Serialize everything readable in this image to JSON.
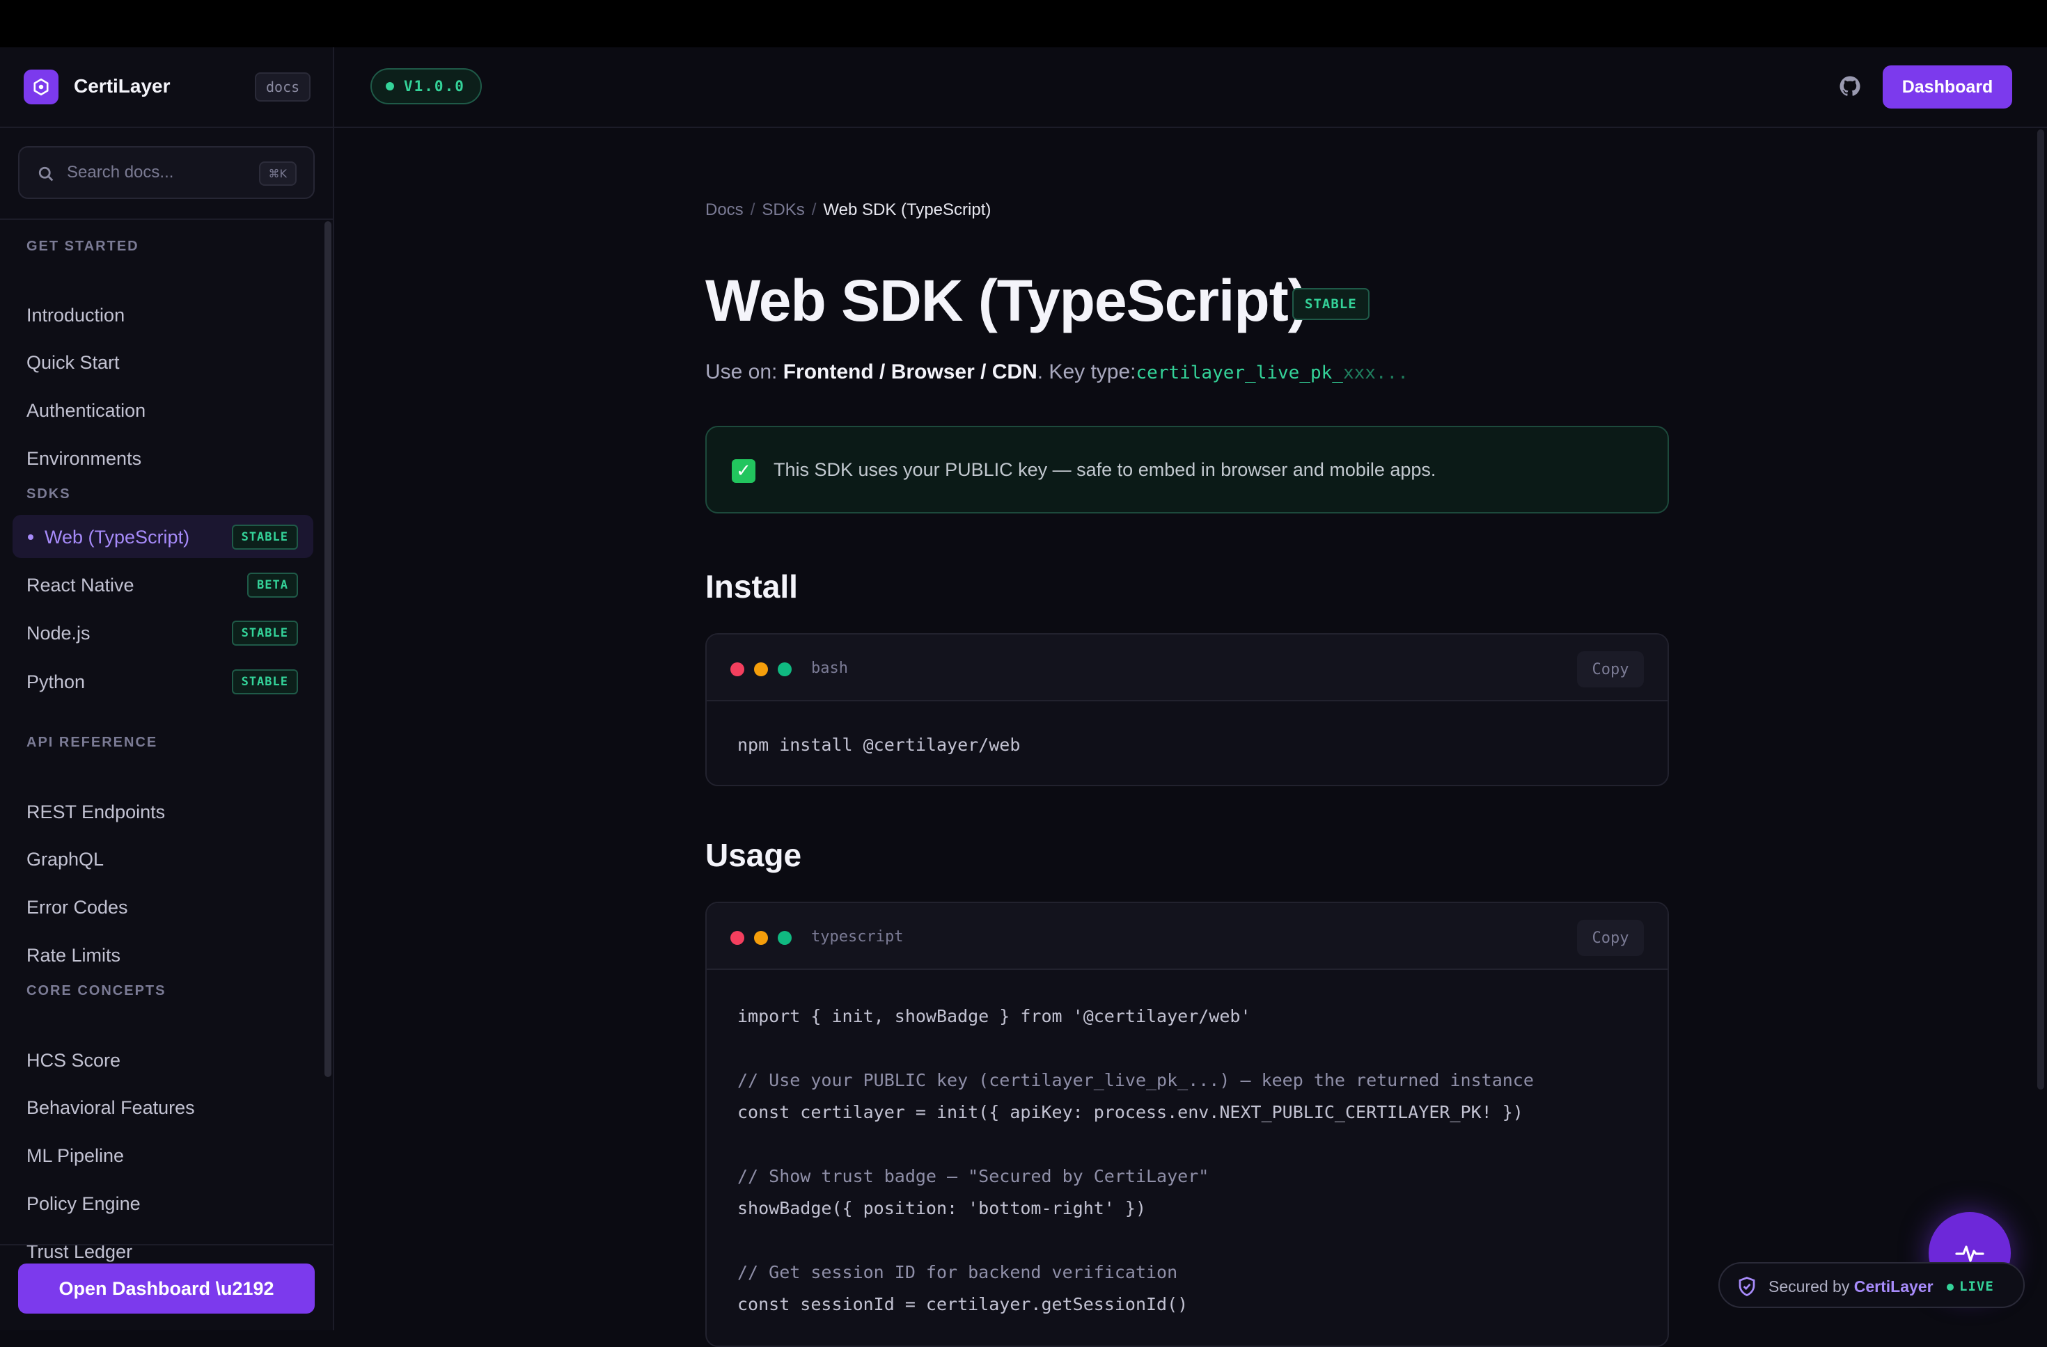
{
  "brand": {
    "name": "CertiLayer",
    "tag": "docs"
  },
  "search": {
    "placeholder": "Search docs...",
    "shortcut": "⌘K"
  },
  "nav": {
    "sections": [
      {
        "title": "GET STARTED",
        "items": [
          {
            "label": "Introduction"
          },
          {
            "label": "Quick Start"
          },
          {
            "label": "Authentication"
          },
          {
            "label": "Environments"
          }
        ]
      },
      {
        "title": "SDKS",
        "items": [
          {
            "label": "Web (TypeScript)",
            "badge": "STABLE",
            "active": true
          },
          {
            "label": "React Native",
            "badge": "BETA"
          },
          {
            "label": "Node.js",
            "badge": "STABLE"
          },
          {
            "label": "Python",
            "badge": "STABLE"
          }
        ]
      },
      {
        "title": "API REFERENCE",
        "items": [
          {
            "label": "REST Endpoints"
          },
          {
            "label": "GraphQL"
          },
          {
            "label": "Error Codes"
          },
          {
            "label": "Rate Limits"
          }
        ]
      },
      {
        "title": "CORE CONCEPTS",
        "items": [
          {
            "label": "HCS Score"
          },
          {
            "label": "Behavioral Features"
          },
          {
            "label": "ML Pipeline"
          },
          {
            "label": "Policy Engine"
          },
          {
            "label": "Trust Ledger"
          }
        ]
      }
    ]
  },
  "sidebar_footer": {
    "button": "Open Dashboard \\u2192"
  },
  "header": {
    "version": "V1.0.0",
    "dashboard_button": "Dashboard",
    "github_icon": "github-icon"
  },
  "breadcrumb": {
    "items": [
      "Docs",
      "SDKs"
    ],
    "current": "Web SDK (TypeScript)"
  },
  "page": {
    "title": "Web SDK (TypeScript)",
    "status": "STABLE",
    "use_on_prefix": "Use on: ",
    "use_on_targets": "Frontend / Browser / CDN",
    "key_type_prefix": ". Key type:",
    "key_type_value": "certilayer_live_pk_",
    "key_type_suffix": "xxx...",
    "callout": "This SDK uses your PUBLIC key — safe to embed in browser and mobile apps.",
    "callout_icon": "check-icon"
  },
  "sections": {
    "install": {
      "heading": "Install",
      "lang": "bash",
      "copy": "Copy",
      "lines": [
        "npm install @certilayer/web"
      ]
    },
    "usage": {
      "heading": "Usage",
      "lang": "typescript",
      "copy": "Copy",
      "lines": [
        "import { init, showBadge } from '@certilayer/web'",
        "",
        "// Use your PUBLIC key (certilayer_live_pk_...) — keep the returned instance",
        "const certilayer = init({ apiKey: process.env.NEXT_PUBLIC_CERTILAYER_PK! })",
        "",
        "// Show trust badge — \"Secured by CertiLayer\"",
        "showBadge({ position: 'bottom-right' })",
        "",
        "// Get session ID for backend verification",
        "const sessionId = certilayer.getSessionId()"
      ]
    }
  },
  "trust_badge": {
    "prefix": "Secured by ",
    "brand": "CertiLayer",
    "status": "LIVE"
  },
  "colors": {
    "accent": "#7c3aed",
    "success": "#34d399",
    "traffic": [
      "#f43f5e",
      "#f59e0b",
      "#10b981"
    ]
  }
}
